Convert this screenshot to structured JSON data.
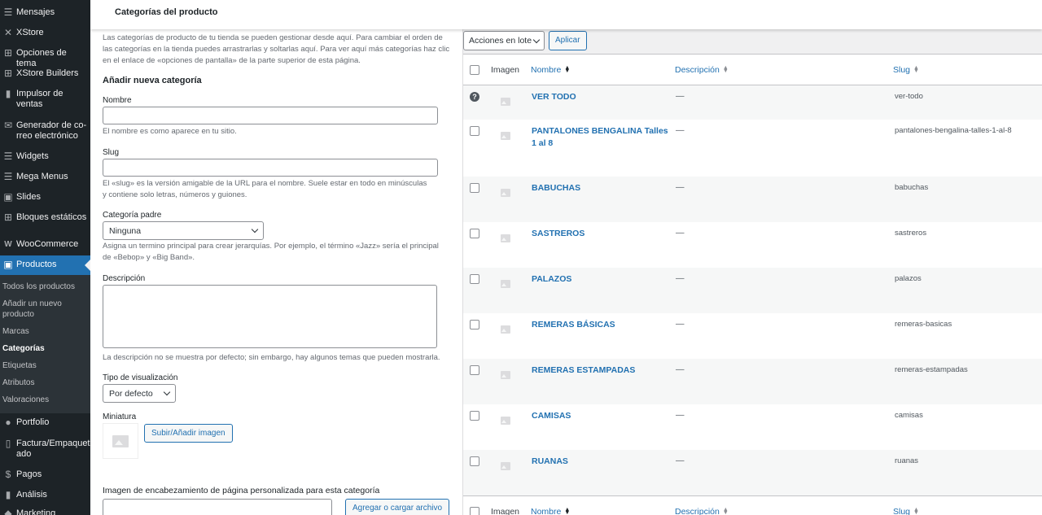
{
  "sidebar": {
    "items_top": [
      {
        "label": "Mensajes",
        "icon": "messages-icon"
      },
      {
        "label": "XStore",
        "icon": "xstore-icon"
      },
      {
        "label": "Opciones de tema",
        "icon": "theme-options-icon"
      },
      {
        "label": "XStore Builders",
        "icon": "builders-icon"
      },
      {
        "label": "Impulsor de ventas",
        "icon": "sales-booster-icon"
      },
      {
        "label": "Generador de co-rreo electrónico",
        "icon": "email-generator-icon"
      },
      {
        "label": "Widgets",
        "icon": "widgets-icon"
      },
      {
        "label": "Mega Menus",
        "icon": "mega-menus-icon"
      },
      {
        "label": "Slides",
        "icon": "slides-icon"
      },
      {
        "label": "Bloques estáticos",
        "icon": "static-blocks-icon"
      }
    ],
    "woocommerce": "WooCommerce",
    "productos": "Productos",
    "submenu": [
      "Todos los productos",
      "Añadir un nuevo producto",
      "Marcas",
      "Categorías",
      "Etiquetas",
      "Atributos",
      "Valoraciones"
    ],
    "items_bottom": [
      {
        "label": "Portfolio",
        "icon": "portfolio-icon"
      },
      {
        "label": "Factura/Empaquet ado",
        "icon": "invoice-icon"
      },
      {
        "label": "Pagos",
        "icon": "payments-icon"
      },
      {
        "label": "Análisis",
        "icon": "analytics-icon"
      },
      {
        "label": "Marketing",
        "icon": "marketing-icon"
      }
    ]
  },
  "page": {
    "title": "Categorías del producto"
  },
  "form": {
    "intro": "Las categorías de producto de tu tienda se pueden gestionar desde aquí. Para cambiar el orden de las categorías en la tienda puedes arrastrarlas y soltarlas aquí. Para ver aquí más categorías haz clic en el enlace de «opciones de pantalla» de la parte superior de esta página.",
    "heading": "Añadir nueva categoría",
    "name_label": "Nombre",
    "name_help": "El nombre es como aparece en tu sitio.",
    "slug_label": "Slug",
    "slug_help": "El «slug» es la versión amigable de la URL para el nombre. Suele estar en todo en minúsculas y contiene solo letras, números y guiones.",
    "parent_label": "Categoría padre",
    "parent_value": "Ninguna",
    "parent_help": "Asigna un termino principal para crear jerarquías. Por ejemplo, el término «Jazz» sería el principal de «Bebop» y «Big Band».",
    "desc_label": "Descripción",
    "desc_help": "La descripción no se muestra por defecto; sin embargo, hay algunos temas que pueden mostrarla.",
    "display_label": "Tipo de visualización",
    "display_value": "Por defecto",
    "thumb_label": "Miniatura",
    "upload_button": "Subir/Añadir imagen",
    "header_image_label": "Imagen de encabezamiento de página personalizada para esta categoría",
    "add_file_button": "Agregar o cargar archivo"
  },
  "table": {
    "bulk_action": "Acciones en lote",
    "apply": "Aplicar",
    "col_image": "Imagen",
    "col_name": "Nombre",
    "col_desc": "Descripción",
    "col_slug": "Slug",
    "rows": [
      {
        "name": "VER TODO",
        "desc": "—",
        "slug": "ver-todo"
      },
      {
        "name": "PANTALONES BENGALINA Talles 1 al 8",
        "desc": "—",
        "slug": "pantalones-bengalina-talles-1-al-8"
      },
      {
        "name": "BABUCHAS",
        "desc": "—",
        "slug": "babuchas"
      },
      {
        "name": "SASTREROS",
        "desc": "—",
        "slug": "sastreros"
      },
      {
        "name": "PALAZOS",
        "desc": "—",
        "slug": "palazos"
      },
      {
        "name": "REMERAS BÁSICAS",
        "desc": "—",
        "slug": "remeras-basicas"
      },
      {
        "name": "REMERAS ESTAMPADAS",
        "desc": "—",
        "slug": "remeras-estampadas"
      },
      {
        "name": "CAMISAS",
        "desc": "—",
        "slug": "camisas"
      },
      {
        "name": "RUANAS",
        "desc": "—",
        "slug": "ruanas"
      }
    ]
  },
  "colors": {
    "sidebar": "#1d2327",
    "accent": "#2271b1",
    "submenu": "#2c3338"
  }
}
